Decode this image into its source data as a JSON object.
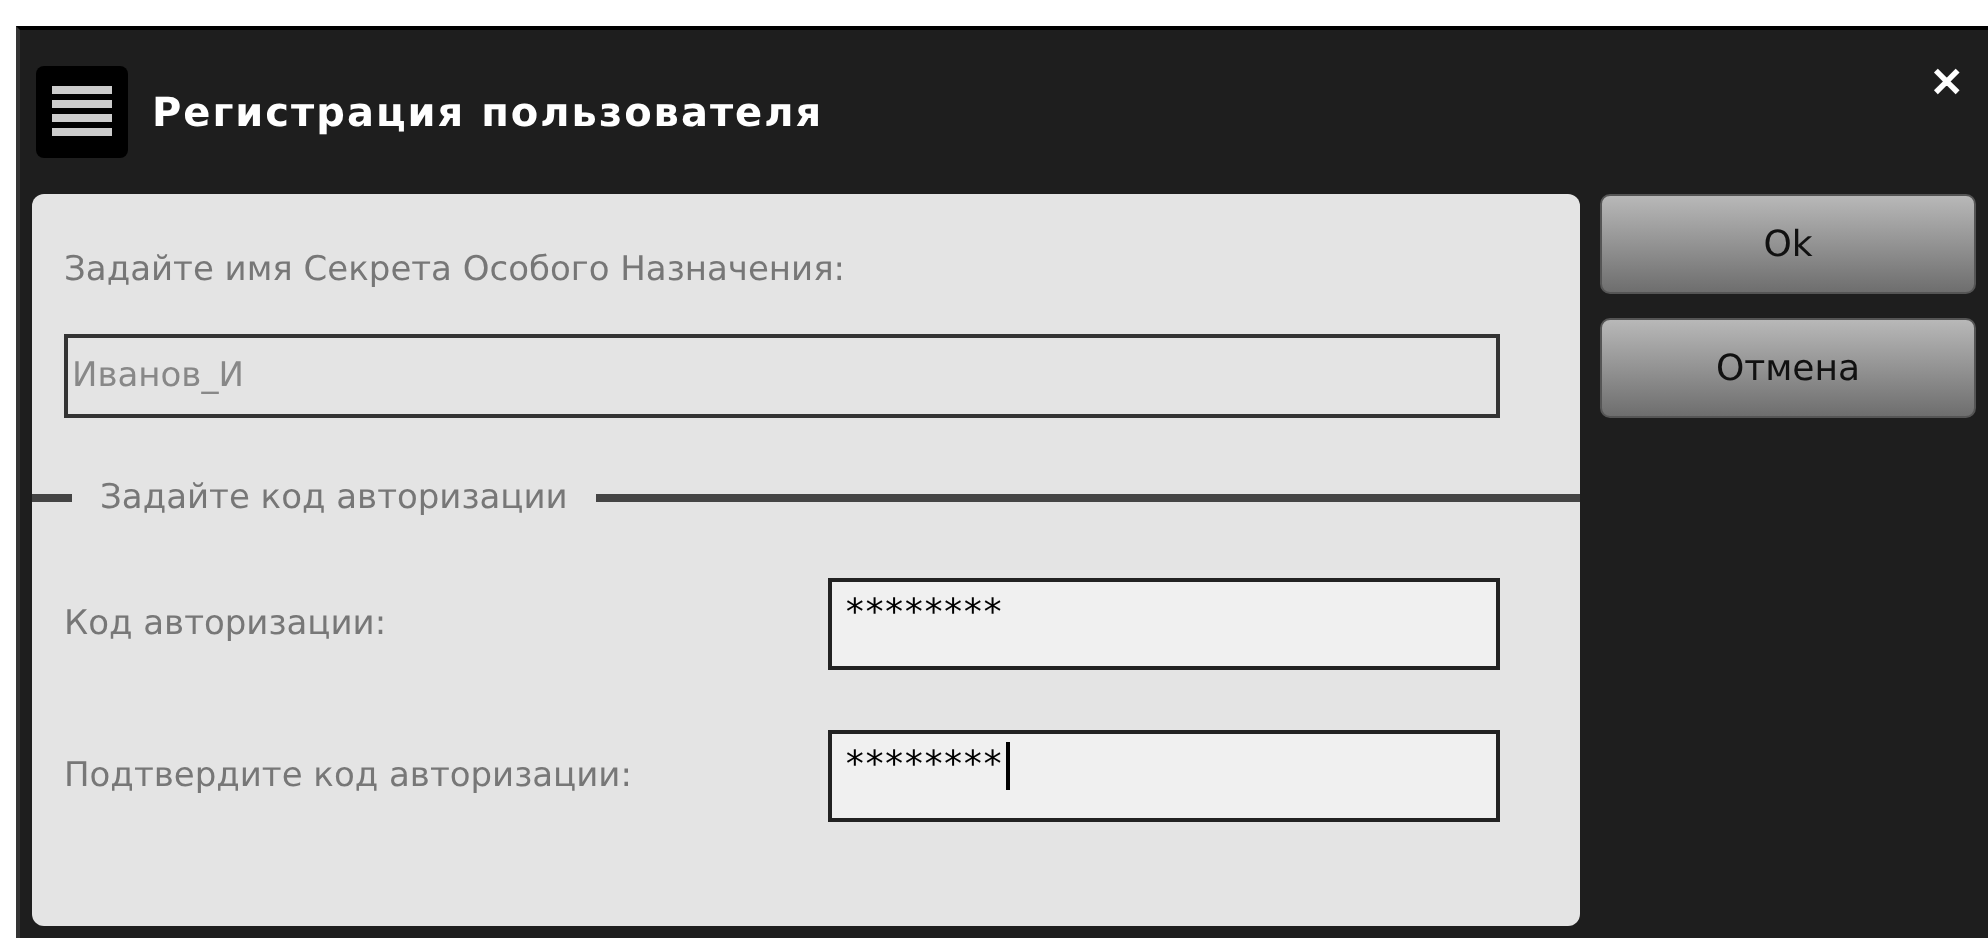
{
  "window": {
    "title": "Регистрация пользователя",
    "close": "✕"
  },
  "name_section": {
    "label": "Задайте имя Секрета Особого Назначения:",
    "value": "Иванов_И"
  },
  "auth_group": {
    "legend": "Задайте код авторизации",
    "fields": [
      {
        "label": "Код авторизации:",
        "value": "********",
        "focused": false
      },
      {
        "label": "Подтвердите код авторизации:",
        "value": "********",
        "focused": true
      }
    ]
  },
  "buttons": [
    "Ok",
    "Отмена"
  ]
}
